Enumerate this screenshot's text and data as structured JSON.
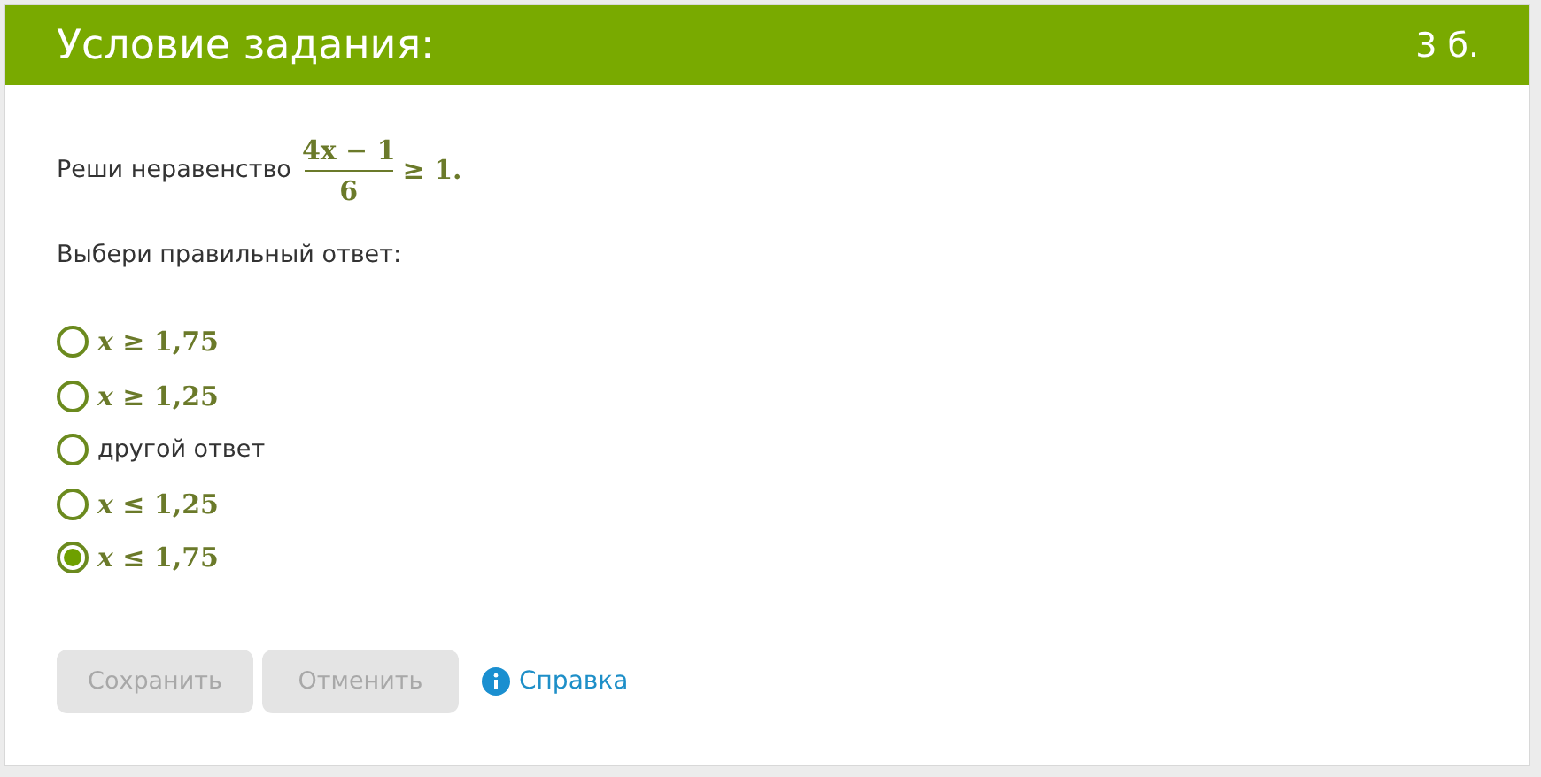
{
  "header": {
    "title": "Условие задания:",
    "points": "3 б."
  },
  "task": {
    "text": "Реши неравенство",
    "numerator": "4x − 1",
    "denominator": "6",
    "tail": "≥ 1",
    "end": "."
  },
  "instruction": "Выбери правильный ответ:",
  "options": [
    {
      "kind": "math",
      "label": "*x* ≥ 1,75",
      "selected": false
    },
    {
      "kind": "math",
      "label": "*x* ≥ 1,25",
      "selected": false
    },
    {
      "kind": "text",
      "label": "другой ответ",
      "selected": false
    },
    {
      "kind": "math",
      "label": "*x* ≤ 1,25",
      "selected": false
    },
    {
      "kind": "math",
      "label": "*x* ≤ 1,75",
      "selected": true
    }
  ],
  "buttons": [
    {
      "label": "Сохранить",
      "disabled": true
    },
    {
      "label": "Отменить",
      "disabled": true
    }
  ],
  "help": {
    "label": "Справка"
  }
}
